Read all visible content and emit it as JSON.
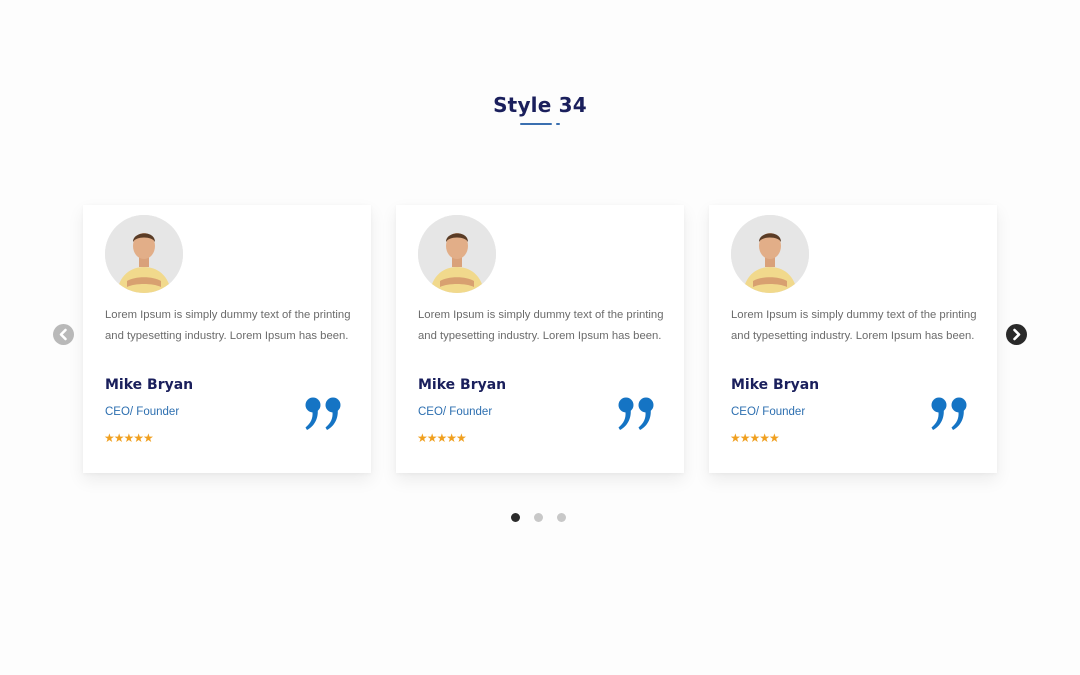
{
  "section": {
    "title": "Style 34"
  },
  "testimonials": [
    {
      "text": "Lorem Ipsum is simply dummy text of the printing and typesetting industry. Lorem Ipsum has been.",
      "name": "Mike Bryan",
      "role": "CEO/ Founder",
      "rating": 5,
      "stars": "★★★★★"
    },
    {
      "text": "Lorem Ipsum is simply dummy text of the printing and typesetting industry. Lorem Ipsum has been.",
      "name": "Mike Bryan",
      "role": "CEO/ Founder",
      "rating": 5,
      "stars": "★★★★★"
    },
    {
      "text": "Lorem Ipsum is simply dummy text of the printing and typesetting industry. Lorem Ipsum has been.",
      "name": "Mike Bryan",
      "role": "CEO/ Founder",
      "rating": 5,
      "stars": "★★★★★"
    }
  ],
  "carousel": {
    "prev_icon": "chevron-left-icon",
    "next_icon": "chevron-right-icon",
    "pages": 3,
    "active_page": 1
  },
  "colors": {
    "heading": "#1a1f5c",
    "role": "#2d6fb0",
    "stars": "#f0a020",
    "quote": "#1574c4"
  }
}
